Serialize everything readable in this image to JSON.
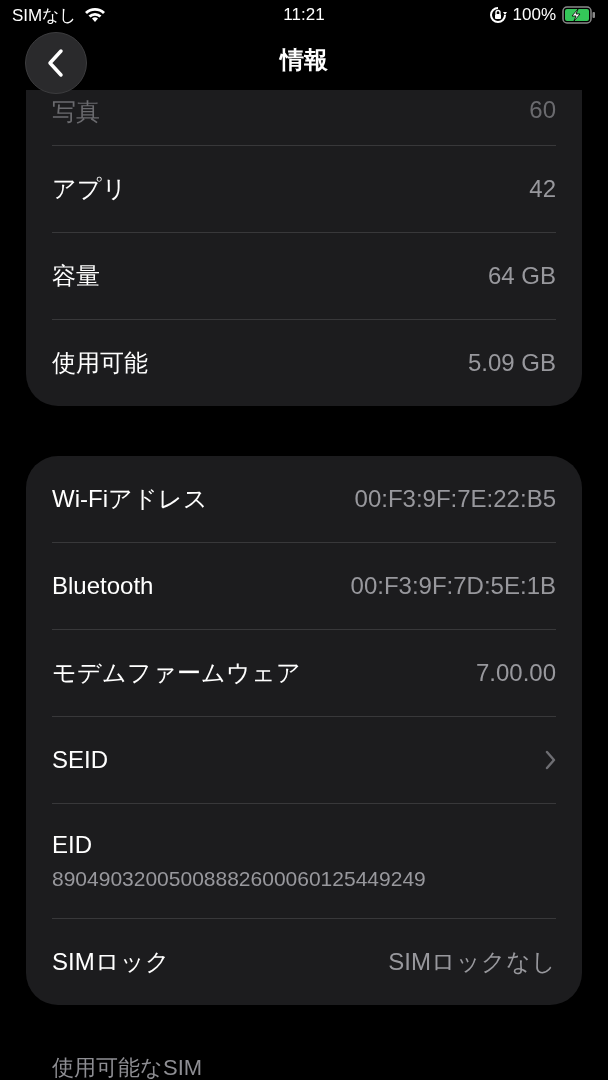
{
  "status_bar": {
    "carrier": "SIMなし",
    "time": "11:21",
    "battery": "100%"
  },
  "nav": {
    "title": "情報"
  },
  "sections": [
    {
      "rows": [
        {
          "kind": "value",
          "label": "写真",
          "value": "60"
        },
        {
          "kind": "value",
          "label": "アプリ",
          "value": "42"
        },
        {
          "kind": "value",
          "label": "容量",
          "value": "64 GB"
        },
        {
          "kind": "value",
          "label": "使用可能",
          "value": "5.09 GB"
        }
      ]
    },
    {
      "rows": [
        {
          "kind": "value",
          "label": "Wi-Fiアドレス",
          "value": "00:F3:9F:7E:22:B5"
        },
        {
          "kind": "value",
          "label": "Bluetooth",
          "value": "00:F3:9F:7D:5E:1B"
        },
        {
          "kind": "value",
          "label": "モデムファームウェア",
          "value": "7.00.00"
        },
        {
          "kind": "link",
          "label": "SEID"
        },
        {
          "kind": "stacked",
          "label": "EID",
          "value": "89049032005008882600060125449249"
        },
        {
          "kind": "value",
          "label": "SIMロック",
          "value": "SIMロックなし"
        }
      ]
    }
  ],
  "next_section": {
    "header": "使用可能なSIM"
  }
}
